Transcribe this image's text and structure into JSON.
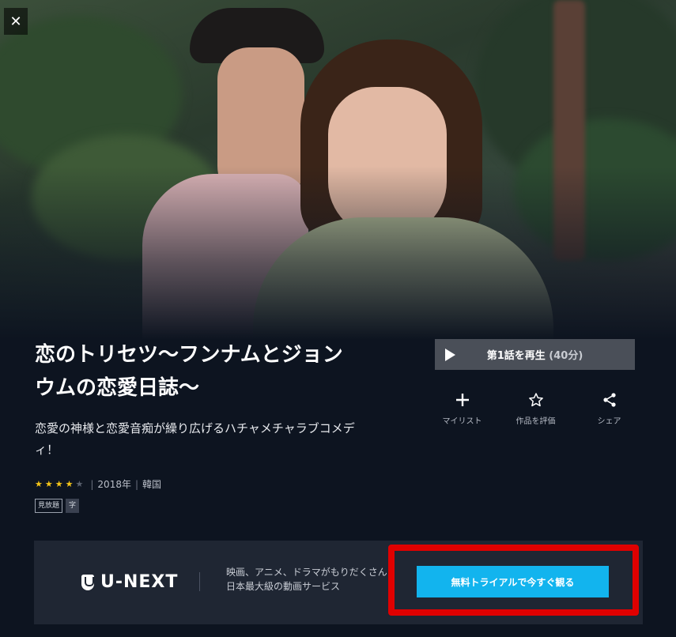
{
  "hero": {
    "image_description_icon": "drama-key-visual"
  },
  "close_label": "✕",
  "title": "恋のトリセツ〜フンナムとジョンウムの恋愛日誌〜",
  "catchphrase": "恋愛の神様と恋愛音痴が繰り広げるハチャメチャラブコメディ！",
  "rating": {
    "value": 4,
    "max": 5
  },
  "meta": {
    "year": "2018年",
    "country": "韓国",
    "separator": "|"
  },
  "badges": [
    "見放題",
    "字"
  ],
  "play": {
    "label": "第1話を再生",
    "duration": "(40分)"
  },
  "actions": [
    {
      "icon": "plus-icon",
      "glyph": "+",
      "label": "マイリスト"
    },
    {
      "icon": "star-outline-icon",
      "glyph": "☆",
      "label": "作品を評価"
    },
    {
      "icon": "share-icon",
      "glyph": "share",
      "label": "シェア"
    }
  ],
  "banner": {
    "logo": "U-NEXT",
    "promo_line1": "映画、アニメ、ドラマがもりだくさん！",
    "promo_line2": "日本最大級の動画サービス",
    "trial_button": "無料トライアルで今すぐ観る"
  },
  "colors": {
    "background": "#0d1420",
    "accent": "#12b4ee",
    "highlight": "#e00000",
    "star": "#f5c518"
  }
}
